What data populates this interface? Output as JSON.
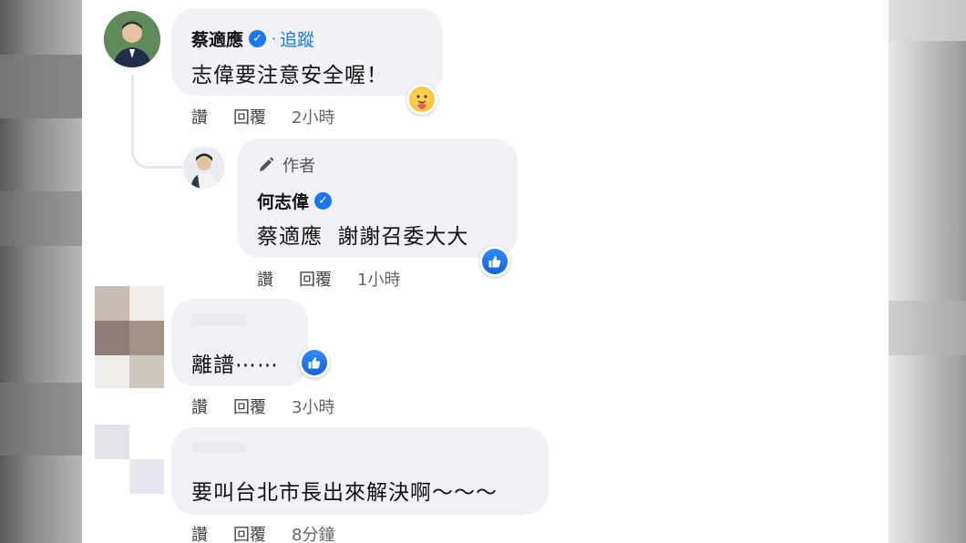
{
  "comments": [
    {
      "name": "蔡適應",
      "dot": "·",
      "follow": "追蹤",
      "text": "志偉要注意安全喔！",
      "like": "讚",
      "reply": "回覆",
      "time": "2小時",
      "reaction": "care-icon"
    },
    {
      "author_label": "作者",
      "name": "何志偉",
      "mention": "蔡適應",
      "text": "謝謝召委大大",
      "like": "讚",
      "reply": "回覆",
      "time": "1小時",
      "reaction": "like-icon"
    },
    {
      "text": "離譜⋯⋯",
      "like": "讚",
      "reply": "回覆",
      "time": "3小時",
      "reaction": "like-icon"
    },
    {
      "text": "要叫台北市長出來解決啊～～～",
      "like": "讚",
      "reply": "回覆",
      "time": "8分鐘"
    }
  ],
  "colors": {
    "bubble": "#f0f2f5",
    "link": "#1877f2",
    "verified": "#1877f2"
  }
}
